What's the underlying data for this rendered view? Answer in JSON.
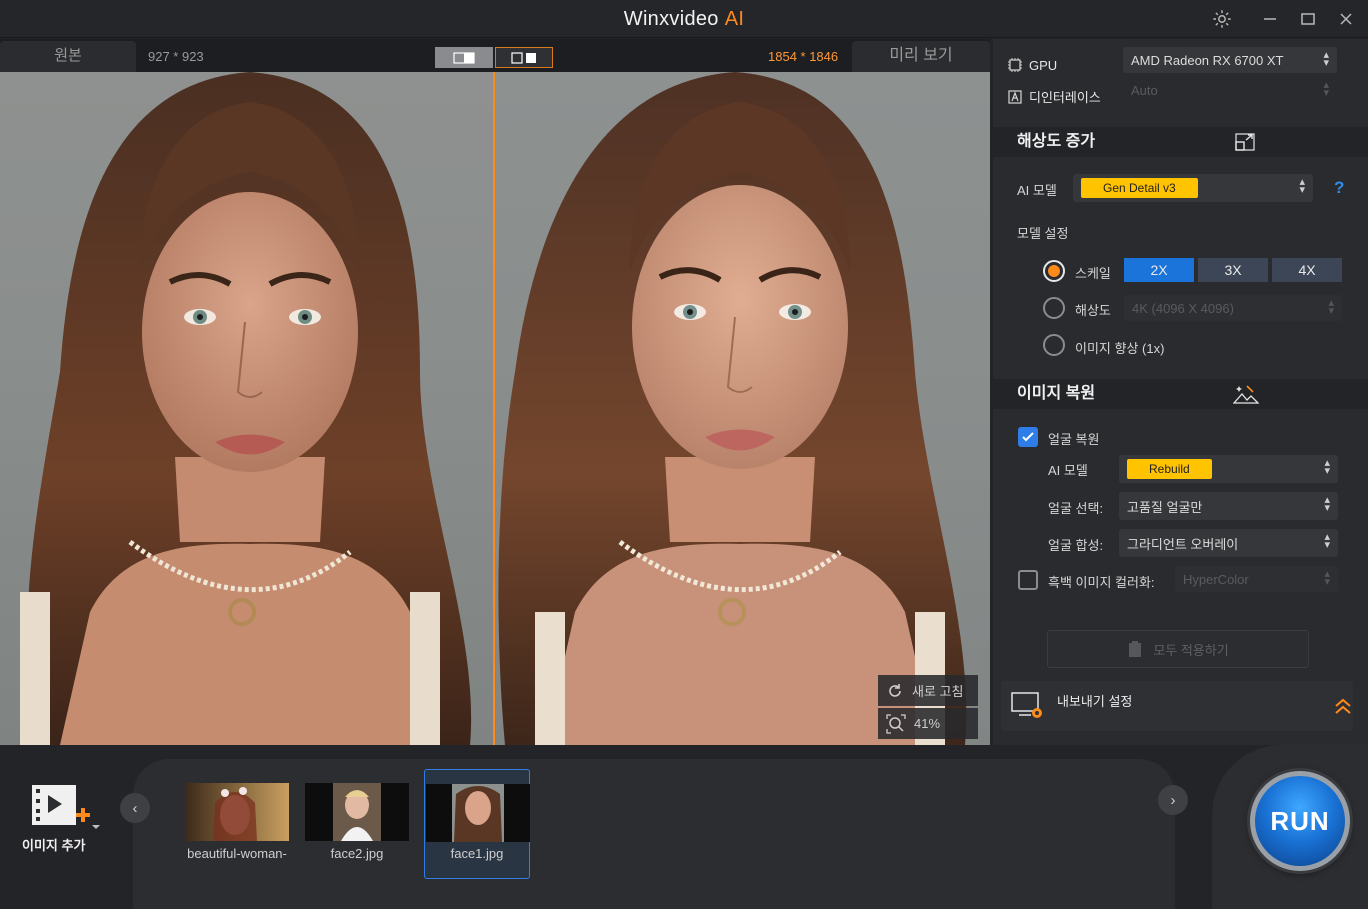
{
  "window": {
    "title": "Winxvideo",
    "title_ai": "AI",
    "settings_icon": "gear-icon",
    "minimize_icon": "minimize-icon",
    "maximize_icon": "maximize-icon",
    "close_icon": "close-icon"
  },
  "viewer": {
    "original_tab": "원본",
    "original_dims": "927 * 923",
    "output_dims": "1854 * 1846",
    "preview_tab": "미리 보기",
    "refresh_label": "새로 고침",
    "zoom_label": "41%",
    "accent_color": "#ff8a1c"
  },
  "panel": {
    "gpu_label": "GPU",
    "gpu_value": "AMD Radeon RX 6700 XT",
    "deinterlace_label": "디인터레이스",
    "deinterlace_value": "Auto",
    "upscale_section": "해상도 증가",
    "ai_model_label": "AI 모델",
    "ai_model_value": "Gen Detail v3",
    "help": "?",
    "model_settings_label": "모델 설정",
    "scale_label": "스케일",
    "scale_options": [
      "2X",
      "3X",
      "4X"
    ],
    "scale_selected": "2X",
    "resolution_label": "해상도",
    "resolution_value": "4K (4096 X 4096)",
    "enhance_label": "이미지 향상 (1x)",
    "restore_section": "이미지 복원",
    "face_restore_label": "얼굴 복원",
    "face_restore_checked": true,
    "face_ai_model_label": "AI 모델",
    "face_ai_model_value": "Rebuild",
    "face_select_label": "얼굴 선택:",
    "face_select_value": "고품질 얼굴만",
    "face_blend_label": "얼굴 합성:",
    "face_blend_value": "그라디언트 오버레이",
    "colorize_label": "흑백 이미지 컬러화:",
    "colorize_value": "HyperColor",
    "colorize_checked": false,
    "apply_all_label": "모두 적용하기",
    "export_label": "내보내기 설정"
  },
  "bottom": {
    "add_image_label": "이미지 추가",
    "thumbnails": [
      {
        "name": "beautiful-woman-"
      },
      {
        "name": "face2.jpg"
      },
      {
        "name": "face1.jpg",
        "selected": true
      }
    ],
    "run_label": "RUN"
  }
}
